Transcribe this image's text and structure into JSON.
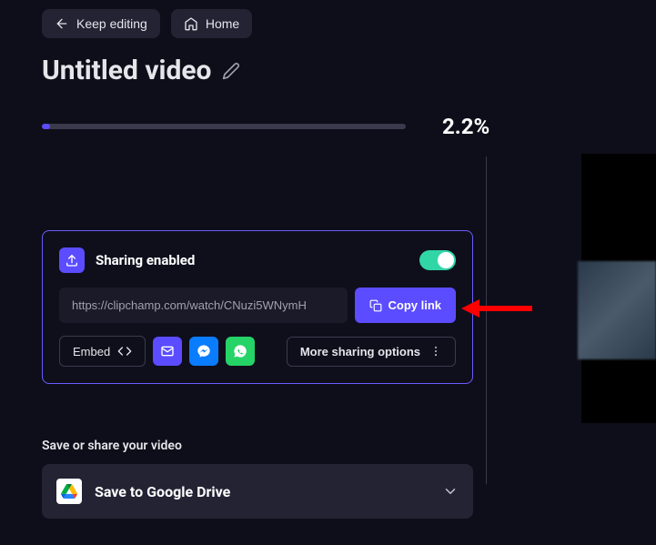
{
  "header": {
    "keep_editing": "Keep editing",
    "home": "Home"
  },
  "title": "Untitled video",
  "progress": {
    "percent_label": "2.2%",
    "percent_value": 2.2
  },
  "sharing": {
    "title": "Sharing enabled",
    "toggle_on": true,
    "url": "https://clipchamp.com/watch/CNuzi5WNymH",
    "copy_label": "Copy link",
    "embed_label": "Embed",
    "more_label": "More sharing options",
    "icons": {
      "email": "email-icon",
      "messenger": "messenger-icon",
      "whatsapp": "whatsapp-icon"
    }
  },
  "save": {
    "section_label": "Save or share your video",
    "option_label": "Save to Google Drive"
  },
  "colors": {
    "accent": "#5b4cff",
    "toggle_on": "#30d6a6",
    "messenger": "#0a7cff",
    "whatsapp": "#25d366",
    "arrow": "#ff0000"
  }
}
